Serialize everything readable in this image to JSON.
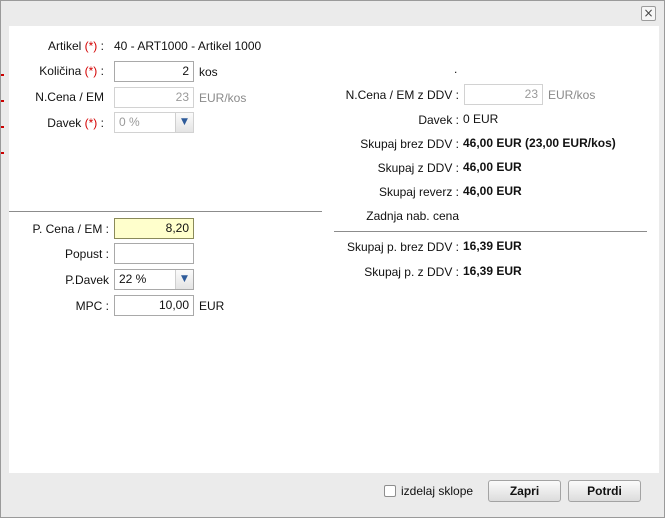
{
  "dialog": {
    "close_glyph": "×"
  },
  "left": {
    "artikel": {
      "label": "Artikel",
      "req": "(*)",
      "colon": ":",
      "value": "40 - ART1000 - Artikel 1000"
    },
    "kolicina": {
      "label": "Količina",
      "req": "(*)",
      "colon": ":",
      "value": "2",
      "unit": "kos"
    },
    "ncena": {
      "label": "N.Cena / EM",
      "value": "23",
      "unit": "EUR/kos"
    },
    "davek": {
      "label": "Davek",
      "req": "(*)",
      "colon": ":",
      "value": "0 %"
    },
    "pcena": {
      "label": "P. Cena / EM :",
      "value": "8,20"
    },
    "popust": {
      "label": "Popust :",
      "value": ""
    },
    "pdavek": {
      "label": "P.Davek",
      "value": "22 %"
    },
    "mpc": {
      "label": "MPC :",
      "value": "10,00",
      "unit": "EUR"
    }
  },
  "right": {
    "dot": ".",
    "ncena_ddv": {
      "label": "N.Cena / EM z DDV :",
      "value": "23",
      "unit": "EUR/kos"
    },
    "davek": {
      "label": "Davek :",
      "value": "0 EUR"
    },
    "skupaj_brez": {
      "label": "Skupaj brez DDV :",
      "value": "46,00 EUR (23,00 EUR/kos)"
    },
    "skupaj_z": {
      "label": "Skupaj z DDV :",
      "value": "46,00 EUR"
    },
    "skupaj_reverz": {
      "label": "Skupaj reverz :",
      "value": "46,00 EUR"
    },
    "zadnja": {
      "label": "Zadnja nab. cena"
    },
    "skupaj_p_brez": {
      "label": "Skupaj p. brez DDV :",
      "value": "16,39 EUR"
    },
    "skupaj_p_z": {
      "label": "Skupaj p. z DDV :",
      "value": "16,39 EUR"
    }
  },
  "footer": {
    "checkbox_label": "izdelaj sklope",
    "close_label": "Zapri",
    "confirm_label": "Potrdi"
  },
  "colors": {
    "required": "#d40000",
    "highlight_input": "#ffffcc"
  },
  "icons": [
    "close-icon",
    "chevron-down-icon"
  ]
}
